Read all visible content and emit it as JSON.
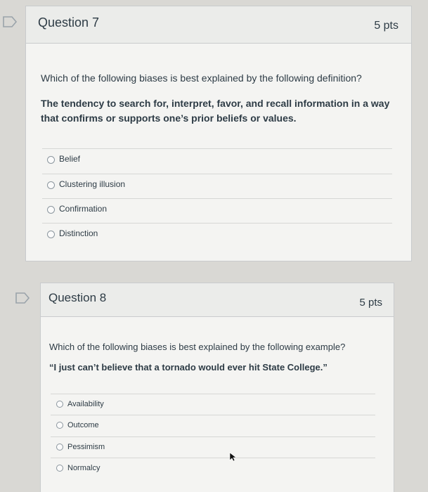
{
  "questions": [
    {
      "title": "Question 7",
      "points": "5 pts",
      "prompt": "Which of the following biases is best explained by the following definition?",
      "stimulus_lines": [
        "The tendency to search for, interpret, favor, and recall information in a way",
        "that confirms or supports one’s prior beliefs or values."
      ],
      "answers": [
        "Belief",
        "Clustering illusion",
        "Confirmation",
        "Distinction"
      ]
    },
    {
      "title": "Question 8",
      "points": "5 pts",
      "prompt": "Which of the following biases is best explained by the following example?",
      "stimulus_lines": [
        "“I just can’t believe that a tornado would ever hit State College.”"
      ],
      "answers": [
        "Availability",
        "Outcome",
        "Pessimism",
        "Normalcy"
      ]
    }
  ]
}
